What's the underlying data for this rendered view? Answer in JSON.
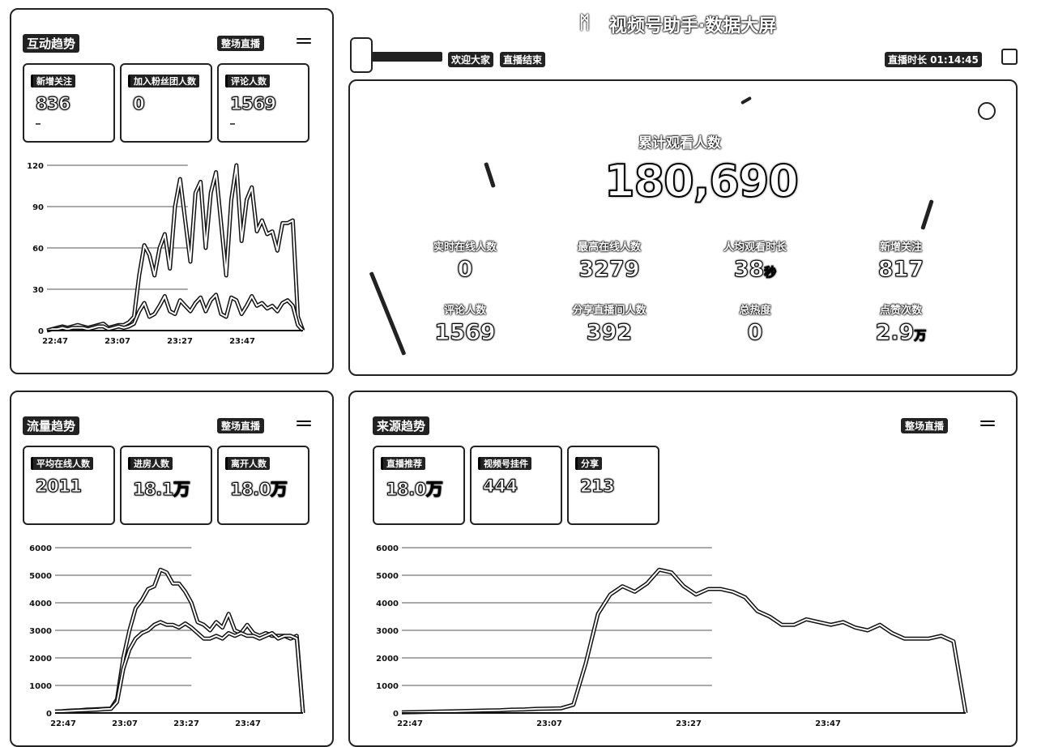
{
  "header": {
    "title": "视频号助手·数据大屏",
    "logo_icon": "wechat-channels-logo-icon",
    "tag_welcome": "欢迎大家",
    "tag_status": "直播结束",
    "duration_label": "直播时长 01:14:45"
  },
  "hero": {
    "total_viewers_label": "累计观看人数",
    "total_viewers": "180,690",
    "metrics": [
      {
        "label": "实时在线人数",
        "value": "0",
        "unit": ""
      },
      {
        "label": "最高在线人数",
        "value": "3279",
        "unit": ""
      },
      {
        "label": "人均观看时长",
        "value": "38",
        "unit": "秒"
      },
      {
        "label": "新增关注",
        "value": "817",
        "unit": ""
      },
      {
        "label": "评论人数",
        "value": "1569",
        "unit": ""
      },
      {
        "label": "分享直播间人数",
        "value": "392",
        "unit": ""
      },
      {
        "label": "总热度",
        "value": "0",
        "unit": ""
      },
      {
        "label": "点赞次数",
        "value": "2.9",
        "unit": "万"
      }
    ]
  },
  "interaction": {
    "title": "互动趋势",
    "dropdown": "整场直播",
    "cards": [
      {
        "label": "新增关注",
        "value": "836"
      },
      {
        "label": "加入粉丝团人数",
        "value": "0"
      },
      {
        "label": "评论人数",
        "value": "1569"
      }
    ]
  },
  "traffic": {
    "title": "流量趋势",
    "dropdown": "整场直播",
    "cards": [
      {
        "label": "平均在线人数",
        "value": "2011"
      },
      {
        "label": "进房人数",
        "value": "18.1万"
      },
      {
        "label": "离开人数",
        "value": "18.0万"
      }
    ]
  },
  "source": {
    "title": "来源趋势",
    "dropdown": "整场直播",
    "cards": [
      {
        "label": "直播推荐",
        "value": "18.0万"
      },
      {
        "label": "视频号挂件",
        "value": "444"
      },
      {
        "label": "分享",
        "value": "213"
      }
    ]
  },
  "chart_data": [
    {
      "id": "interaction",
      "type": "line",
      "x_ticks": [
        "22:47",
        "23:07",
        "23:27",
        "23:47"
      ],
      "y_ticks": [
        "0",
        "30",
        "60",
        "90",
        "120"
      ],
      "ylim": [
        0,
        120
      ],
      "series": [
        {
          "values": [
            0,
            1,
            2,
            3,
            2,
            3,
            4,
            3,
            2,
            3,
            4,
            5,
            2,
            3,
            4,
            4,
            6,
            10,
            40,
            62,
            55,
            40,
            60,
            70,
            45,
            90,
            110,
            80,
            50,
            100,
            108,
            60,
            100,
            115,
            78,
            40,
            95,
            120,
            65,
            95,
            104,
            72,
            80,
            70,
            72,
            58,
            78,
            78,
            80,
            10,
            0
          ]
        },
        {
          "values": [
            0,
            1,
            1,
            2,
            1,
            2,
            2,
            2,
            1,
            2,
            3,
            3,
            1,
            2,
            3,
            2,
            3,
            5,
            14,
            20,
            10,
            12,
            18,
            25,
            14,
            12,
            22,
            18,
            14,
            20,
            24,
            14,
            22,
            26,
            12,
            10,
            24,
            22,
            12,
            18,
            25,
            18,
            20,
            16,
            18,
            14,
            20,
            22,
            18,
            4,
            0
          ]
        }
      ]
    },
    {
      "id": "traffic",
      "type": "line",
      "x_ticks": [
        "22:47",
        "23:07",
        "23:27",
        "23:47"
      ],
      "y_ticks": [
        "0",
        "1000",
        "2000",
        "3000",
        "4000",
        "5000",
        "6000"
      ],
      "ylim": [
        0,
        6000
      ],
      "series": [
        {
          "values": [
            50,
            60,
            80,
            90,
            100,
            120,
            130,
            140,
            150,
            160,
            500,
            2000,
            3000,
            3800,
            4100,
            4500,
            4600,
            5200,
            5100,
            4700,
            4700,
            4400,
            4000,
            3300,
            3200,
            3000,
            3300,
            3100,
            3600,
            3000,
            2900,
            3200,
            2900,
            2800,
            2900,
            2800,
            2800,
            2800,
            2700,
            2800,
            0
          ]
        },
        {
          "values": [
            50,
            60,
            70,
            80,
            90,
            100,
            110,
            120,
            140,
            150,
            400,
            1600,
            2300,
            2700,
            2900,
            3000,
            3200,
            3300,
            3200,
            3200,
            3100,
            3250,
            3100,
            2900,
            2700,
            2700,
            2800,
            2700,
            2900,
            2800,
            2900,
            2800,
            2800,
            2700,
            2800,
            2900,
            2700,
            2800,
            2800,
            2700,
            0
          ]
        }
      ]
    },
    {
      "id": "source",
      "type": "line",
      "x_ticks": [
        "22:47",
        "23:07",
        "23:27",
        "23:47"
      ],
      "y_ticks": [
        "0",
        "1000",
        "2000",
        "3000",
        "4000",
        "5000",
        "6000"
      ],
      "ylim": [
        0,
        6000
      ],
      "series": [
        {
          "values": [
            20,
            30,
            40,
            50,
            60,
            70,
            80,
            90,
            100,
            120,
            130,
            150,
            160,
            170,
            300,
            1800,
            3600,
            4300,
            4600,
            4400,
            4700,
            5200,
            5100,
            4600,
            4300,
            4500,
            4500,
            4400,
            4200,
            3700,
            3500,
            3200,
            3200,
            3400,
            3300,
            3200,
            3300,
            3100,
            3000,
            3200,
            2900,
            2700,
            2700,
            2700,
            2800,
            2600,
            0
          ]
        }
      ]
    }
  ]
}
